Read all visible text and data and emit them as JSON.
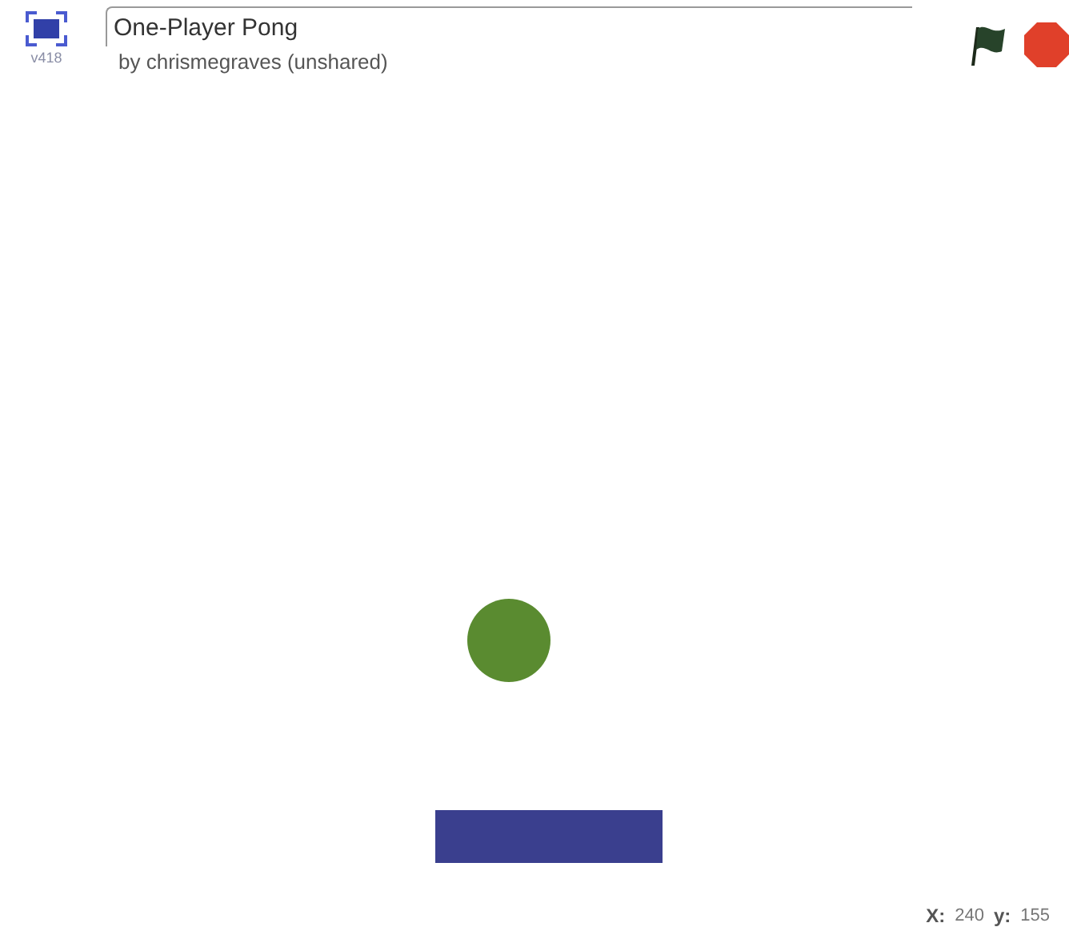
{
  "header": {
    "version": "v418",
    "title": "One-Player Pong",
    "byline": "by chrismegraves (unshared)"
  },
  "readout": {
    "x_label": "X:",
    "x_value": "240",
    "y_label": "y:",
    "y_value": "155"
  }
}
